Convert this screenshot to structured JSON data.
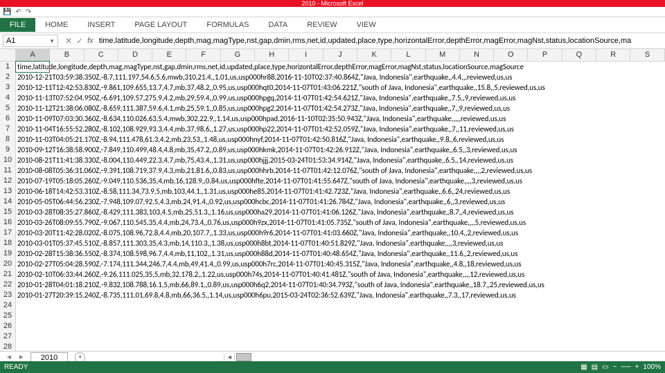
{
  "title_suffix": "2010 - Microsoft Excel",
  "qat_icons": [
    "save-icon",
    "undo-icon",
    "redo-icon"
  ],
  "tabs": {
    "file": "FILE",
    "home": "HOME",
    "insert": "INSERT",
    "pagelayout": "PAGE LAYOUT",
    "formulas": "FORMULAS",
    "data": "DATA",
    "review": "REVIEW",
    "view": "VIEW"
  },
  "namebox": "A1",
  "formula_text": "time,latitude,longitude,depth,mag,magType,nst,gap,dmin,rms,net,id,updated,place,type,horizontalError,depthError,magError,magNst,status,locationSource,ma",
  "columns": [
    "A",
    "B",
    "C",
    "D",
    "E",
    "F",
    "G",
    "H",
    "I",
    "J",
    "K",
    "L",
    "M",
    "N",
    "O",
    "P",
    "Q",
    "R",
    "S"
  ],
  "selected_col": "A",
  "rows": [
    {
      "n": 1,
      "t": "time,latitude,longitude,depth,mag,magType,nst,gap,dmin,rms,net,id,updated,place,type,horizontalError,depthError,magError,magNst,status,locationSource,magSource"
    },
    {
      "n": 2,
      "t": "2010-12-21T03:59:38.350Z,-8.7,111.197,54.6,5.6,mwb,310,21.4,,1.01,us,usp000hr88,2016-11-10T02:37:40.864Z,\"Java, Indonesia\",earthquake,,4.4,,,reviewed,us,us"
    },
    {
      "n": 3,
      "t": "2010-12-11T12:42:53.830Z,-9.861,109.655,13.7,4.7,mb,37,48.2,,0.95,us,usp000hqt0,2014-11-07T01:43:06.221Z,\"south of Java, Indonesia\",earthquake,,15.8,,5,reviewed,us,us"
    },
    {
      "n": 4,
      "t": "2010-11-13T07:52:04.950Z,-6.691,109.57,275.9,4.2,mb,29,59.4,,0.99,us,usp000hpgq,2014-11-07T01:42:54.621Z,\"Java, Indonesia\",earthquake,,7.5,,9,reviewed,us,us"
    },
    {
      "n": 5,
      "t": "2010-11-12T21:38:06.080Z,-8.659,111.387,59.6,4.1,mb,25,59.1,,0.85,us,usp000hpg2,2014-11-07T01:42:54.273Z,\"Java, Indonesia\",earthquake,,7,,9,reviewed,us,us"
    },
    {
      "n": 6,
      "t": "2010-11-09T07:03:30.360Z,-8.634,110.026,63,5.4,mwb,302,22.9,,1.14,us,usp000hpad,2016-11-10T02:35:50.943Z,\"Java, Indonesia\",earthquake,,,,,reviewed,us,us"
    },
    {
      "n": 7,
      "t": "2010-11-04T16:55:52.280Z,-8.102,108.929,93.3,4.4,mb,37,98.6,,1.27,us,usp000hp22,2014-11-07T01:42:52.059Z,\"Java, Indonesia\",earthquake,,7,,11,reviewed,us,us"
    },
    {
      "n": 8,
      "t": "2010-11-03T04:05:21.170Z,-8.94,111.478,61.3,4.2,mb,23,53,,1.48,us,usp000hnyf,2014-11-07T01:42:50.816Z,\"Java, Indonesia\",earthquake,,9.8,,6,reviewed,us,us"
    },
    {
      "n": 9,
      "t": "2010-09-12T16:38:58.900Z,-7.849,110.499,48.4,4.8,mb,35,47.2,,0.89,us,usp000hkmk,2014-11-07T01:42:26.912Z,\"Java, Indonesia\",earthquake,,6.5,,3,reviewed,us,us"
    },
    {
      "n": 10,
      "t": "2010-08-21T11:41:38.330Z,-8.004,110.449,22.3,4.7,mb,75,43.4,,1.31,us,usp000hjjj,2015-03-24T01:53:34.914Z,\"Java, Indonesia\",earthquake,,6.5,,14,reviewed,us,us"
    },
    {
      "n": 11,
      "t": "2010-08-08T05:36:31.060Z,-9.391,108.719,37.9,4.3,mb,21,81.6,,0.83,us,usp000hhrb,2014-11-07T01:42:12.076Z,\"south of Java, Indonesia\",earthquake,,,,2,reviewed,us,us"
    },
    {
      "n": 12,
      "t": "2010-07-19T05:18:05.260Z,-9.049,110.536,35,4,mb,16,128.9,,0.84,us,usp000hfte,2014-11-07T01:41:55.647Z,\"south of Java, Indonesia\",earthquake,,,,3,reviewed,us,us"
    },
    {
      "n": 13,
      "t": "2010-06-18T14:42:53.310Z,-8.58,111.34,73.9,5,mb,103,44.1,,1.31,us,usp000he85,2014-11-07T01:41:42.723Z,\"Java, Indonesia\",earthquake,,6.6,,24,reviewed,us,us"
    },
    {
      "n": 14,
      "t": "2010-05-05T06:44:56.230Z,-7.948,109.07,92.5,4.3,mb,24,91.4,,0.92,us,usp000hcbc,2014-11-07T01:41:26.784Z,\"Java, Indonesia\",earthquake,,6,,3,reviewed,us,us"
    },
    {
      "n": 15,
      "t": "2010-03-28T08:35:27.860Z,-8.429,111.383,103,4.5,mb,25,51.3,,1.16,us,usp000ha29,2014-11-07T01:41:06.126Z,\"Java, Indonesia\",earthquake,,8.7,,4,reviewed,us,us"
    },
    {
      "n": 16,
      "t": "2010-03-26T08:09:55.790Z,-9.067,110.545,35,4.4,mb,24,73.4,,0.76,us,usp000h9zx,2014-11-07T01:41:05.735Z,\"south of Java, Indonesia\",earthquake,,,,5,reviewed,us,us"
    },
    {
      "n": 17,
      "t": "2010-03-20T11:42:28.020Z,-8.075,108.96,72.8,4.4,mb,20,107.7,,1.33,us,usp000h9r6,2014-11-07T01:41:03.660Z,\"Java, Indonesia\",earthquake,,10.4,,2,reviewed,us,us"
    },
    {
      "n": 18,
      "t": "2010-03-01T05:37:45.510Z,-8.857,111.303,35,4.3,mb,14,110.3,,1.38,us,usp000h8bt,2014-11-07T01:40:51.829Z,\"Java, Indonesia\",earthquake,,,,3,reviewed,us,us"
    },
    {
      "n": 19,
      "t": "2010-02-28T15:38:36.550Z,-8.374,108.598,96.7,4.4,mb,11,102,,1.31,us,usp000h88d,2014-11-07T01:40:48.654Z,\"Java, Indonesia\",earthquake,,11.6,,2,reviewed,us,us"
    },
    {
      "n": 20,
      "t": "2010-02-27T05:04:28.590Z,-7.174,111.344,246.7,4.4,mb,49,41.4,,0.99,us,usp000h7rc,2014-11-07T01:40:45.315Z,\"Java, Indonesia\",earthquake,,4.8,,18,reviewed,us,us"
    },
    {
      "n": 21,
      "t": "2010-02-10T06:33:44.260Z,-9.26,111.025,35,5,mb,32,178.2,,1.22,us,usp000h74s,2014-11-07T01:40:41.481Z,\"south of Java, Indonesia\",earthquake,,,,12,reviewed,us,us"
    },
    {
      "n": 22,
      "t": "2010-01-28T04:01:18.210Z,-9.832,108.788,16.1,5,mb,66,89.1,,0.89,us,usp000h6q2,2014-11-07T01:40:34.793Z,\"south of Java, Indonesia\",earthquake,,18.7,,25,reviewed,us,us"
    },
    {
      "n": 23,
      "t": "2010-01-27T20:39:15.240Z,-8.735,111.01,69.8,4.8,mb,66,36.5,,1.14,us,usp000h6pu,2015-03-24T02:36:52.639Z,\"Java, Indonesia\",earthquake,,7.3,,17,reviewed,us,us"
    },
    {
      "n": 24,
      "t": ""
    },
    {
      "n": 25,
      "t": ""
    },
    {
      "n": 26,
      "t": ""
    },
    {
      "n": 27,
      "t": ""
    },
    {
      "n": 28,
      "t": ""
    }
  ],
  "sheet_tab": "2010",
  "status": "READY",
  "zoom": "100%"
}
